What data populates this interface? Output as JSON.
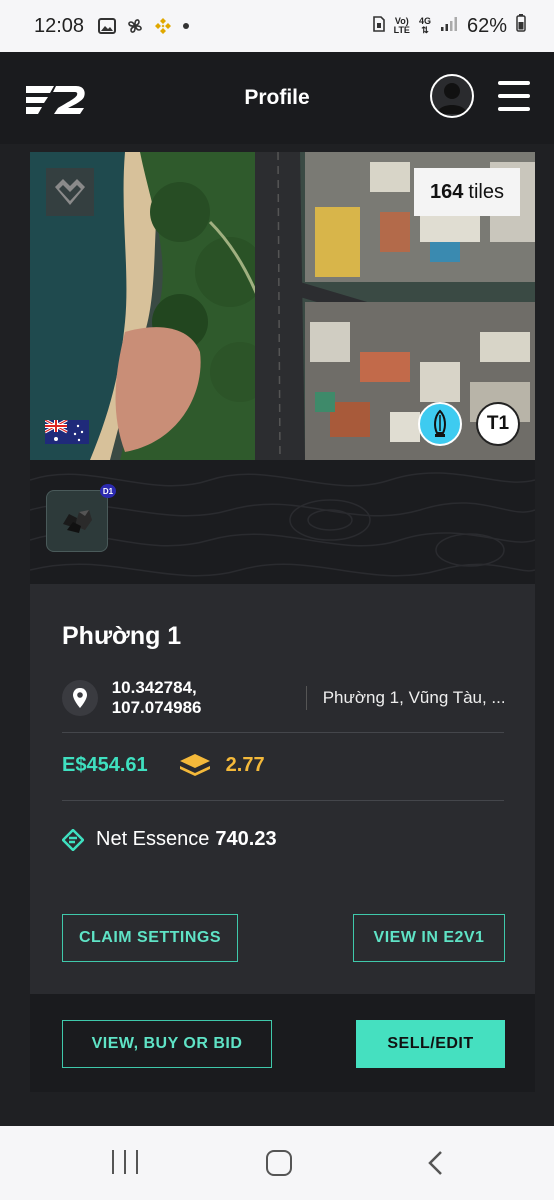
{
  "status_bar": {
    "time": "12:08",
    "network_top": "Vo)",
    "network_bottom": "LTE",
    "data_top": "4G",
    "battery": "62%"
  },
  "header": {
    "title": "Profile"
  },
  "map": {
    "tiles_count": "164",
    "tiles_label": "tiles",
    "tier_label": "T1",
    "flag_icon": "australia-flag-icon"
  },
  "resource": {
    "badge": "D1",
    "icon": "coal-icon"
  },
  "property": {
    "name": "Phường 1",
    "coordinates": "10.342784, 107.074986",
    "address": "Phường 1, Vũng Tàu, ...",
    "price": "E$454.61",
    "yield": "2.77",
    "essence_label": "Net Essence",
    "essence_value": "740.23"
  },
  "buttons": {
    "claim_settings": "CLAIM SETTINGS",
    "view_e2v1": "VIEW IN E2V1",
    "view_buy_bid": "VIEW, BUY OR BID",
    "sell_edit": "SELL/EDIT"
  },
  "colors": {
    "accent": "#45e0c0",
    "yield": "#f4b93a",
    "background": "#1f2023",
    "panel": "#2a2b2f"
  }
}
